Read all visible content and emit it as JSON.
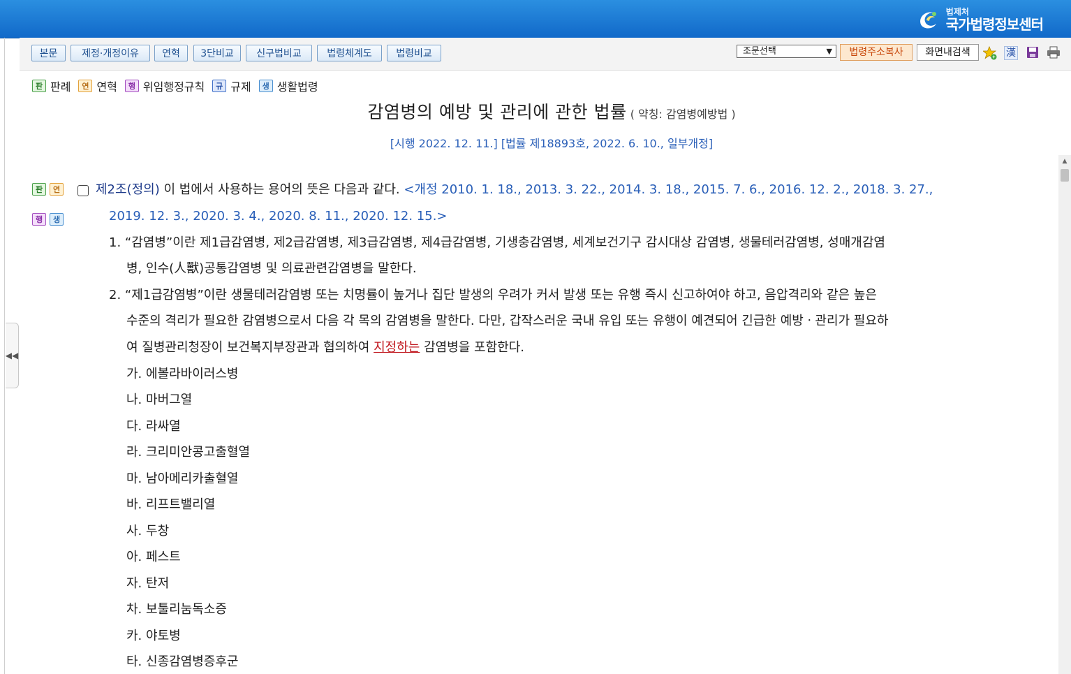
{
  "header": {
    "logo_small": "법제처",
    "logo_big": "국가법령정보센터"
  },
  "toolbar": {
    "tabs": [
      "본문",
      "제정·개정이유",
      "연혁",
      "3단비교",
      "신구법비교",
      "법령체계도",
      "법령비교"
    ],
    "article_select": "조문선택",
    "copy_url": "법령주소복사",
    "search_in_page": "화면내검색",
    "icons": [
      "star-plus-icon",
      "hanja-icon",
      "save-icon",
      "print-icon"
    ],
    "hanja_glyph": "漢"
  },
  "legend": [
    {
      "badge": "판",
      "label": "판례"
    },
    {
      "badge": "연",
      "label": "연혁"
    },
    {
      "badge": "행",
      "label": "위임행정규칙"
    },
    {
      "badge": "규",
      "label": "규제"
    },
    {
      "badge": "생",
      "label": "생활법령"
    }
  ],
  "law": {
    "title": "감염병의 예방 및 관리에 관한 법률",
    "abbr": "( 약칭: 감염병예방법 )",
    "enforcement": "[시행 2022. 12. 11.] [법률 제18893호, 2022. 6. 10., 일부개정]"
  },
  "article": {
    "badges": [
      "판",
      "연",
      "행",
      "생"
    ],
    "title": "제2조(정의)",
    "intro": " 이 법에서 사용하는 용어의 뜻은 다음과 같다. ",
    "amend_1": "<개정 2010. 1. 18., 2013. 3. 22., 2014. 3. 18., 2015. 7. 6., 2016. 12. 2., 2018. 3. 27.,",
    "amend_2": "2019. 12. 3., 2020. 3. 4., 2020. 8. 11., 2020. 12. 15.>",
    "item1_a": "1. “감염병”이란 제1급감염병, 제2급감염병, 제3급감염병, 제4급감염병, 기생충감염병, 세계보건기구 감시대상 감염병, 생물테러감염병, 성매개감염",
    "item1_b": "병, 인수(人獸)공통감염병 및 의료관련감염병을 말한다.",
    "item2_a": "2. “제1급감염병”이란 생물테러감염병 또는 치명률이 높거나 집단 발생의 우려가 커서 발생 또는 유행 즉시 신고하여야 하고, 음압격리와 같은 높은",
    "item2_b": "수준의 격리가 필요한 감염병으로서 다음 각 목의 감염병을 말한다. 다만, 갑작스러운 국내 유입 또는 유행이 예견되어 긴급한 예방ㆍ관리가 필요하",
    "item2_c_pre": "여 질병관리청장이 보건복지부장관과 협의하여 ",
    "item2_c_link": "지정하는",
    "item2_c_post": " 감염병을 포함한다.",
    "subitems": [
      "가. 에볼라바이러스병",
      "나. 마버그열",
      "다. 라싸열",
      "라. 크리미안콩고출혈열",
      "마. 남아메리카출혈열",
      "바. 리프트밸리열",
      "사. 두창",
      "아. 페스트",
      "자. 탄저",
      "차. 보툴리눔독소증",
      "카. 야토병",
      "타. 신종감염병증후군"
    ]
  }
}
